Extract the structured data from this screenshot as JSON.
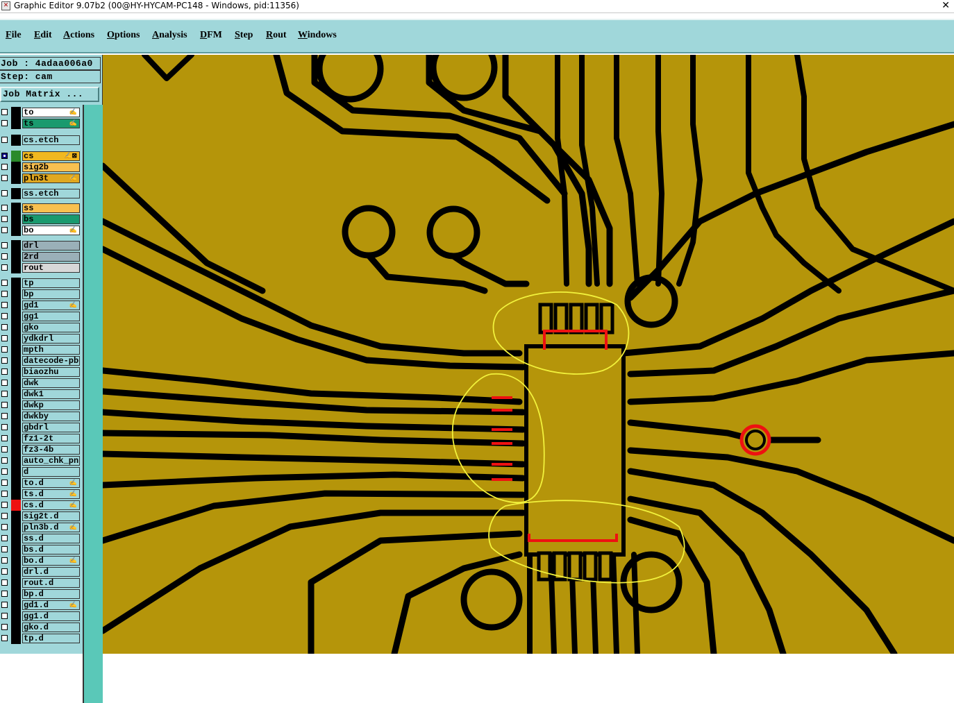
{
  "window": {
    "title": "Graphic Editor 9.07b2 (00@HY-HYCAM-PC148 - Windows, pid:11356)",
    "close_glyph": "✕"
  },
  "menu": [
    "File",
    "Edit",
    "Actions",
    "Options",
    "Analysis",
    "DFM",
    "Step",
    "Rout",
    "Windows"
  ],
  "job_info": {
    "job": "Job : 4adaa006a0",
    "step": "Step: cam"
  },
  "job_matrix_label": "Job Matrix ...",
  "layers": [
    {
      "name": "to",
      "color": "#ffffff",
      "swatch": "#000000",
      "mark": "✍"
    },
    {
      "name": "ts",
      "color": "#1a9a6e",
      "swatch": "#000000",
      "mark": "✍"
    },
    {
      "name": "cs.etch",
      "color": "#a0d7da",
      "swatch": "#000000",
      "mark": ""
    },
    {
      "name": "cs",
      "color": "#f0b820",
      "swatch": "#2a8a2a",
      "mark": "✍⊠",
      "selected": true
    },
    {
      "name": "sig2b",
      "color": "#f8c050",
      "swatch": "#000000",
      "mark": ""
    },
    {
      "name": "pln3t",
      "color": "#e0a820",
      "swatch": "#000000",
      "mark": "✍"
    },
    {
      "name": "ss.etch",
      "color": "#a0d7da",
      "swatch": "#000000",
      "mark": ""
    },
    {
      "name": "ss",
      "color": "#f8c050",
      "swatch": "#000000",
      "mark": ""
    },
    {
      "name": "bs",
      "color": "#1a9a6e",
      "swatch": "#000000",
      "mark": ""
    },
    {
      "name": "bo",
      "color": "#ffffff",
      "swatch": "#000000",
      "mark": "✍"
    },
    {
      "name": "drl",
      "color": "#9ab0b8",
      "swatch": "#000000",
      "mark": ""
    },
    {
      "name": "2rd",
      "color": "#9ab0b8",
      "swatch": "#000000",
      "mark": ""
    },
    {
      "name": "rout",
      "color": "#d8d8d8",
      "swatch": "#000000",
      "mark": ""
    },
    {
      "name": "tp",
      "color": "#a0d7da",
      "swatch": "#000000",
      "mark": ""
    },
    {
      "name": "bp",
      "color": "#a0d7da",
      "swatch": "#000000",
      "mark": ""
    },
    {
      "name": "gd1",
      "color": "#a0d7da",
      "swatch": "#000000",
      "mark": "✍"
    },
    {
      "name": "gg1",
      "color": "#a0d7da",
      "swatch": "#000000",
      "mark": ""
    },
    {
      "name": "gko",
      "color": "#a0d7da",
      "swatch": "#000000",
      "mark": ""
    },
    {
      "name": "ydkdrl",
      "color": "#a0d7da",
      "swatch": "#000000",
      "mark": ""
    },
    {
      "name": "mpth",
      "color": "#a0d7da",
      "swatch": "#000000",
      "mark": ""
    },
    {
      "name": "datecode-pbe",
      "color": "#a0d7da",
      "swatch": "#000000",
      "mark": ""
    },
    {
      "name": "biaozhu",
      "color": "#a0d7da",
      "swatch": "#000000",
      "mark": ""
    },
    {
      "name": "dwk",
      "color": "#a0d7da",
      "swatch": "#000000",
      "mark": ""
    },
    {
      "name": "dwk1",
      "color": "#a0d7da",
      "swatch": "#000000",
      "mark": ""
    },
    {
      "name": "dwkp",
      "color": "#a0d7da",
      "swatch": "#000000",
      "mark": ""
    },
    {
      "name": "dwkby",
      "color": "#a0d7da",
      "swatch": "#000000",
      "mark": ""
    },
    {
      "name": "gbdrl",
      "color": "#a0d7da",
      "swatch": "#000000",
      "mark": ""
    },
    {
      "name": "fz1-2t",
      "color": "#a0d7da",
      "swatch": "#000000",
      "mark": ""
    },
    {
      "name": "fz3-4b",
      "color": "#a0d7da",
      "swatch": "#000000",
      "mark": ""
    },
    {
      "name": "auto_chk_pn",
      "color": "#a0d7da",
      "swatch": "#000000",
      "mark": ""
    },
    {
      "name": "d",
      "color": "#a0d7da",
      "swatch": "#000000",
      "mark": ""
    },
    {
      "name": "to.d",
      "color": "#a0d7da",
      "swatch": "#000000",
      "mark": "✍"
    },
    {
      "name": "ts.d",
      "color": "#a0d7da",
      "swatch": "#000000",
      "mark": "✍"
    },
    {
      "name": "cs.d",
      "color": "#a0d7da",
      "swatch": "#ee1111",
      "mark": "✍"
    },
    {
      "name": "sig2t.d",
      "color": "#a0d7da",
      "swatch": "#000000",
      "mark": ""
    },
    {
      "name": "pln3b.d",
      "color": "#a0d7da",
      "swatch": "#000000",
      "mark": "✍"
    },
    {
      "name": "ss.d",
      "color": "#a0d7da",
      "swatch": "#000000",
      "mark": ""
    },
    {
      "name": "bs.d",
      "color": "#a0d7da",
      "swatch": "#000000",
      "mark": ""
    },
    {
      "name": "bo.d",
      "color": "#a0d7da",
      "swatch": "#000000",
      "mark": "✍"
    },
    {
      "name": "drl.d",
      "color": "#a0d7da",
      "swatch": "#000000",
      "mark": ""
    },
    {
      "name": "rout.d",
      "color": "#a0d7da",
      "swatch": "#000000",
      "mark": ""
    },
    {
      "name": "bp.d",
      "color": "#a0d7da",
      "swatch": "#000000",
      "mark": ""
    },
    {
      "name": "gd1.d",
      "color": "#a0d7da",
      "swatch": "#000000",
      "mark": "✍"
    },
    {
      "name": "gg1.d",
      "color": "#a0d7da",
      "swatch": "#000000",
      "mark": ""
    },
    {
      "name": "gko.d",
      "color": "#a0d7da",
      "swatch": "#000000",
      "mark": ""
    },
    {
      "name": "tp.d",
      "color": "#a0d7da",
      "swatch": "#000000",
      "mark": ""
    }
  ],
  "colors": {
    "copper": "#b5950a",
    "clearance": "#000000",
    "highlight": "#ee1111",
    "annotation": "#f2f23c",
    "panel": "#a0d7da",
    "scroll_strip": "#5ac8b8"
  }
}
